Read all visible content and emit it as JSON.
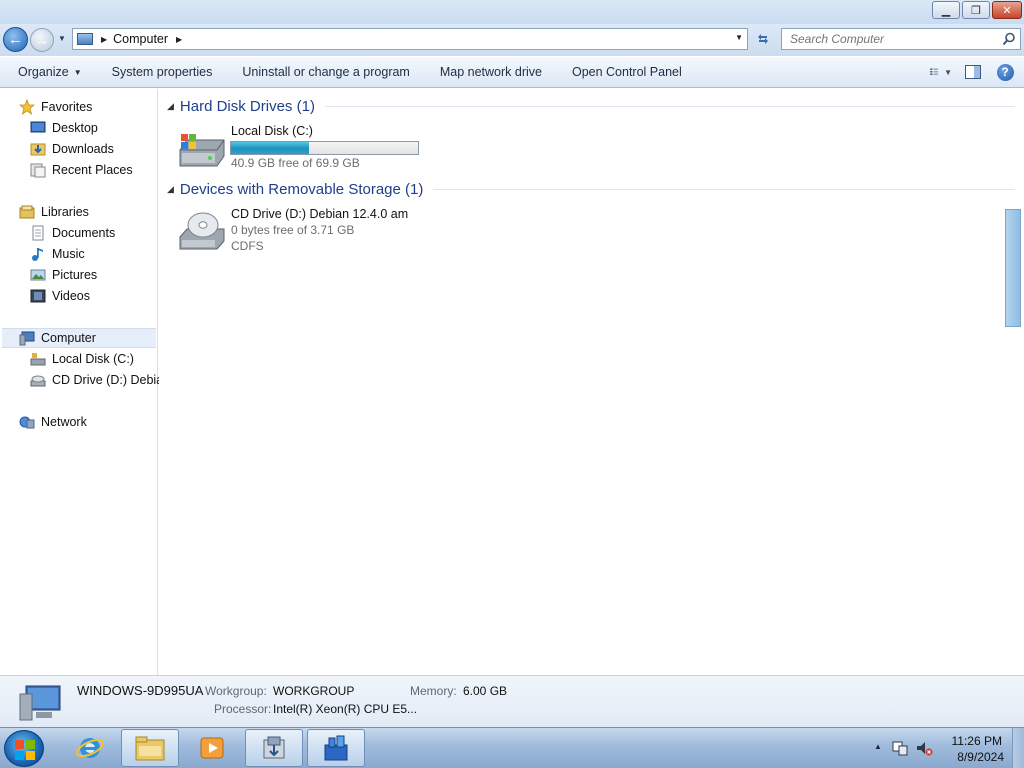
{
  "window": {
    "minimize_glyph": "▁",
    "maximize_glyph": "❐",
    "close_glyph": "✕"
  },
  "address": {
    "path": "Computer",
    "search_placeholder": "Search Computer"
  },
  "toolbar": {
    "organize": "Organize",
    "system_properties": "System properties",
    "uninstall": "Uninstall or change a program",
    "map_drive": "Map network drive",
    "control_panel": "Open Control Panel"
  },
  "nav": {
    "favorites": "Favorites",
    "desktop": "Desktop",
    "downloads": "Downloads",
    "recent": "Recent Places",
    "libraries": "Libraries",
    "documents": "Documents",
    "music": "Music",
    "pictures": "Pictures",
    "videos": "Videos",
    "computer": "Computer",
    "local_disk": "Local Disk (C:)",
    "cd_drive": "CD Drive (D:) Debiar",
    "network": "Network"
  },
  "groups": {
    "hdd_title": "Hard Disk Drives (1)",
    "removable_title": "Devices with Removable Storage (1)"
  },
  "drives": {
    "local": {
      "name": "Local Disk (C:)",
      "free_text": "40.9 GB free of 69.9 GB",
      "used_fraction": 0.415
    },
    "cd": {
      "name": "CD Drive (D:) Debian 12.4.0 am",
      "free_text": "0 bytes free of 3.71 GB",
      "fs": "CDFS"
    }
  },
  "details": {
    "computer_name": "WINDOWS-9D995UA",
    "workgroup_label": "Workgroup:",
    "workgroup": "WORKGROUP",
    "memory_label": "Memory:",
    "memory": "6.00 GB",
    "processor_label": "Processor:",
    "processor": "Intel(R) Xeon(R) CPU E5..."
  },
  "taskbar": {
    "time": "11:26 PM",
    "date": "8/9/2024"
  },
  "colors": {
    "accent": "#1e3f8c",
    "drive_fill": "#1f90bb",
    "taskbar": "#9fbbdc"
  }
}
